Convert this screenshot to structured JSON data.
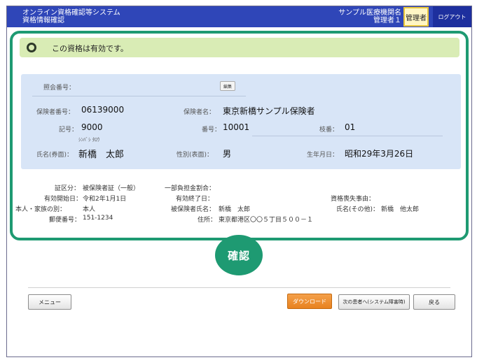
{
  "header": {
    "title_line1": "オンライン資格確認等システム",
    "title_line2": "資格情報確認",
    "facility_name": "サンプル医療機関名",
    "user_name": "管理者１",
    "role_label": "管理者",
    "logout_label": "ログアウト"
  },
  "status": {
    "message": "この資格は有効です。"
  },
  "info": {
    "inquiry_number_label": "照会番号：",
    "edit_label": "編集",
    "insurer_number_label": "保険者番号：",
    "insurer_number": "06139000",
    "insurer_name_label": "保険者名：",
    "insurer_name": "東京新橋サンプル保険者",
    "symbol_label": "記号：",
    "symbol": "9000",
    "number_label": "番号：",
    "number": "10001",
    "branch_label": "枝番：",
    "branch": "01",
    "name_kana": "ｼﾝﾊﾞｼ ﾀﾛｳ",
    "name_label": "氏名(券面)：",
    "name": "新橋　太郎",
    "sex_label": "性別(表面)：",
    "sex": "男",
    "birth_label": "生年月日：",
    "birth": "昭和29年3月26日"
  },
  "details": {
    "cert_type_label": "証区分：",
    "cert_type": "被保険者証（一般）",
    "copay_label": "一部負担金割合：",
    "valid_start_label": "有効開始日：",
    "valid_start": "令和2年1月1日",
    "valid_end_label": "有効終了日：",
    "loss_reason_label": "資格喪失事由：",
    "relation_label": "本人・家族の別：",
    "relation": "本人",
    "insured_name_label": "被保険者氏名：",
    "insured_name": "新橋　太郎",
    "other_name_label": "氏名(その他)：",
    "other_name": "新橋　他太郎",
    "postal_label": "郵便番号：",
    "postal": "151-1234",
    "address_label": "住所：",
    "address": "東京都港区〇〇５丁目５００－１"
  },
  "confirm_label": "確認",
  "footer": {
    "menu_label": "メニュー",
    "download_label": "ダウンロード",
    "next_patient_label": "次の患者へ(システム障害時)",
    "back_label": "戻る"
  },
  "colors": {
    "header_bg": "#2f46b8",
    "accent_green": "#1e9a72",
    "status_bg": "#d9ecb5",
    "info_bg": "#d8e5f7",
    "download_orange": "#e8821f",
    "role_highlight": "#fff6c4"
  }
}
